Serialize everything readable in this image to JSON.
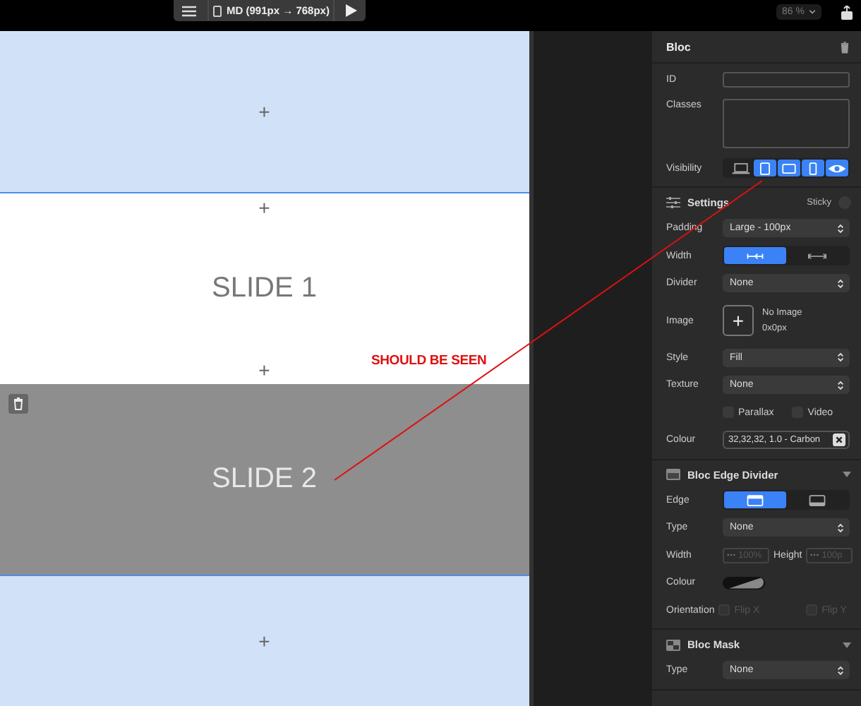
{
  "toolbar": {
    "device": "MD (991px → 768px)",
    "zoom": "86 %"
  },
  "blocks": [
    {
      "kind": "add",
      "label": "+"
    },
    {
      "kind": "slide",
      "title": "SLIDE 1",
      "selected": false,
      "add_top": "+",
      "add_bottom": "+"
    },
    {
      "kind": "slide",
      "title": "SLIDE 2",
      "selected": true
    },
    {
      "kind": "add",
      "label": "+"
    }
  ],
  "annotation": {
    "text": "SHOULD BE SEEN"
  },
  "panel": {
    "title": "Bloc",
    "rows": [
      {
        "kind": "input",
        "label": "ID"
      },
      {
        "kind": "textarea",
        "label": "Classes"
      },
      {
        "kind": "segments",
        "label": "Visibility",
        "segments": [
          {
            "kind": "laptop",
            "selected": false
          },
          {
            "kind": "tablet",
            "selected": true
          },
          {
            "kind": "tablet-wide",
            "selected": true
          },
          {
            "kind": "phone",
            "selected": true
          },
          {
            "kind": "eye",
            "selected": true
          }
        ]
      }
    ],
    "sections": [
      {
        "kind": "settings",
        "title": "Settings",
        "toggle": {
          "label": "Sticky",
          "checked": false
        },
        "rows": [
          {
            "kind": "select",
            "label": "Padding",
            "value": "Large - 100px"
          },
          {
            "kind": "segments",
            "label": "Width",
            "segments": [
              {
                "kind": "width-in",
                "selected": true
              },
              {
                "kind": "width-out",
                "selected": false
              }
            ]
          },
          {
            "kind": "select",
            "label": "Divider",
            "value": "None"
          },
          {
            "kind": "image",
            "label": "Image",
            "button": "+",
            "text": "No Image",
            "size": "0x0px"
          },
          {
            "kind": "select",
            "label": "Style",
            "value": "Fill"
          },
          {
            "kind": "select",
            "label": "Texture",
            "value": "None"
          },
          {
            "kind": "checks",
            "items": [
              {
                "label": "Parallax",
                "checked": false
              },
              {
                "label": "Video",
                "checked": false
              }
            ]
          },
          {
            "kind": "colour",
            "label": "Colour",
            "value": "32,32,32, 1.0 - Carbon"
          }
        ]
      },
      {
        "kind": "edge",
        "title": "Bloc Edge Divider",
        "expanded": true,
        "rows": [
          {
            "kind": "segments",
            "label": "Edge",
            "segments": [
              {
                "kind": "edge-top",
                "selected": true
              },
              {
                "kind": "edge-bottom",
                "selected": false
              }
            ]
          },
          {
            "kind": "select",
            "label": "Type",
            "value": "None"
          },
          {
            "kind": "dims",
            "disabled": true,
            "items": [
              {
                "label": "Width",
                "placeholder": "100%"
              },
              {
                "label": "Height",
                "placeholder": "100p"
              }
            ]
          },
          {
            "kind": "swatch",
            "label": "Colour"
          },
          {
            "kind": "flips",
            "label": "Orientation",
            "disabled": true,
            "items": [
              {
                "label": "Flip X",
                "checked": false
              },
              {
                "label": "Flip Y",
                "checked": false
              }
            ]
          }
        ]
      },
      {
        "kind": "mask",
        "title": "Bloc Mask",
        "expanded": true,
        "rows": [
          {
            "kind": "select",
            "label": "Type",
            "value": "None"
          }
        ]
      }
    ]
  }
}
